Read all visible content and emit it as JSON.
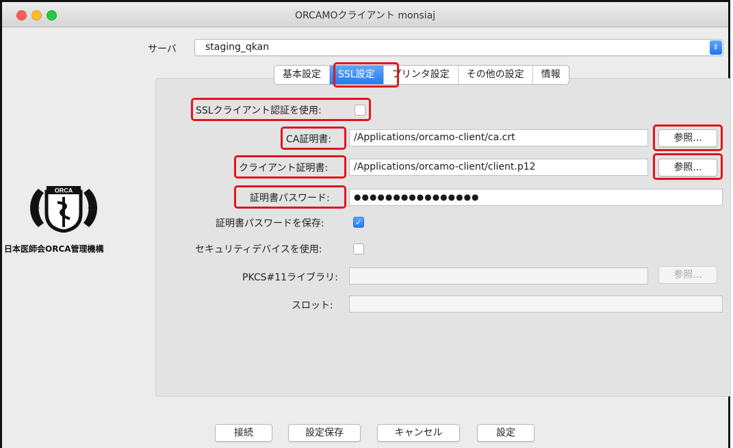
{
  "window": {
    "title": "ORCAMOクライアント monsiaj"
  },
  "branding": {
    "org_name": "日本医師会ORCA管理機構",
    "logo_text": "ORCA"
  },
  "server": {
    "label": "サーバ",
    "value": "staging_qkan"
  },
  "tabs": [
    {
      "label": "基本設定",
      "active": false
    },
    {
      "label": "SSL設定",
      "active": true
    },
    {
      "label": "プリンタ設定",
      "active": false
    },
    {
      "label": "その他の設定",
      "active": false
    },
    {
      "label": "情報",
      "active": false
    }
  ],
  "ssl": {
    "client_auth": {
      "label": "SSLクライアント認証を使用:",
      "checked": false
    },
    "ca_cert": {
      "label": "CA証明書:",
      "value": "/Applications/orcamo-client/ca.crt",
      "button": "参照..."
    },
    "client_cert": {
      "label": "クライアント証明書:",
      "value": "/Applications/orcamo-client/client.p12",
      "button": "参照..."
    },
    "cert_password": {
      "label": "証明書パスワード:",
      "value": "●●●●●●●●●●●●●●●●"
    },
    "save_password": {
      "label": "証明書パスワードを保存:",
      "checked": true
    },
    "security_device": {
      "label": "セキュリティデバイスを使用:",
      "checked": false
    },
    "pkcs11": {
      "label": "PKCS#11ライブラリ:",
      "value": "",
      "button": "参照..."
    },
    "slot": {
      "label": "スロット:",
      "value": ""
    }
  },
  "footer": {
    "connect": "接続",
    "save_settings": "設定保存",
    "cancel": "キャンセル",
    "settings": "設定"
  },
  "colors": {
    "highlight": "#e1141c",
    "accent": "#2479f3"
  }
}
